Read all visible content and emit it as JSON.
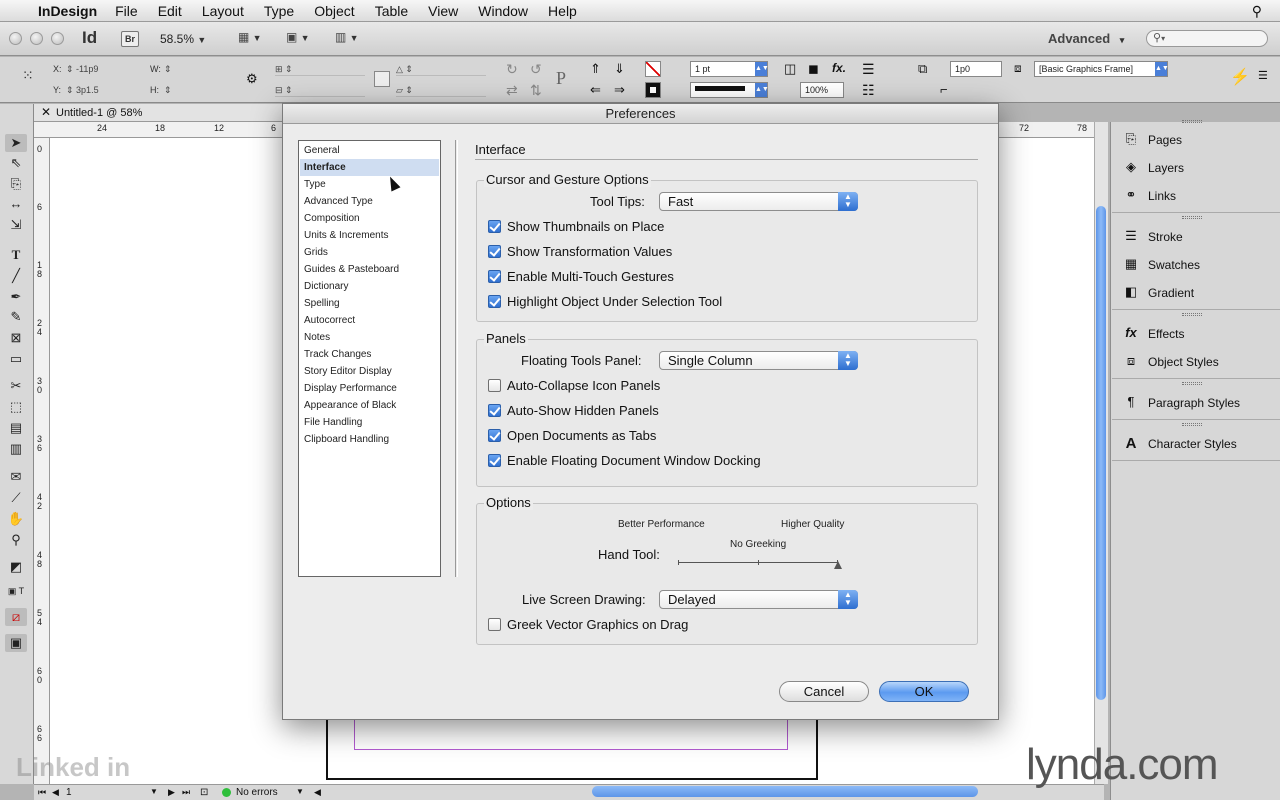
{
  "menubar": {
    "app_name": "InDesign",
    "items": [
      "File",
      "Edit",
      "Layout",
      "Type",
      "Object",
      "Table",
      "View",
      "Window",
      "Help"
    ]
  },
  "appbar": {
    "id_logo": "Id",
    "br_label": "Br",
    "zoom": "58.5%",
    "workspace": "Advanced"
  },
  "control": {
    "x_label": "X:",
    "x_value": "-11p9",
    "y_label": "Y:",
    "y_value": "3p1.5",
    "w_label": "W:",
    "h_label": "H:",
    "stroke_weight": "1 pt",
    "opacity": "100%",
    "fx_label": "fx.",
    "frame_value": "1p0",
    "object_style": "[Basic Graphics Frame]"
  },
  "document": {
    "tab_title": "Untitled-1 @ 58%",
    "ruler_top": [
      "24",
      "18",
      "12",
      "6",
      "72",
      "78"
    ],
    "ruler_left": [
      "0",
      "6",
      "1",
      "8",
      "2",
      "4",
      "3",
      "0",
      "3",
      "6",
      "4",
      "2",
      "4",
      "8",
      "5",
      "4",
      "6",
      "0",
      "6",
      "6"
    ]
  },
  "status": {
    "page": "1",
    "errors": "No errors"
  },
  "panels": [
    {
      "icon": "pages-icon",
      "label": "Pages"
    },
    {
      "icon": "layers-icon",
      "label": "Layers"
    },
    {
      "icon": "links-icon",
      "label": "Links"
    },
    {
      "icon": "stroke-icon",
      "label": "Stroke"
    },
    {
      "icon": "swatches-icon",
      "label": "Swatches"
    },
    {
      "icon": "gradient-icon",
      "label": "Gradient"
    },
    {
      "icon": "effects-icon",
      "label": "Effects"
    },
    {
      "icon": "object-styles-icon",
      "label": "Object Styles"
    },
    {
      "icon": "paragraph-styles-icon",
      "label": "Paragraph Styles"
    },
    {
      "icon": "character-styles-icon",
      "label": "Character Styles"
    }
  ],
  "dialog": {
    "title": "Preferences",
    "categories": [
      "General",
      "Interface",
      "Type",
      "Advanced Type",
      "Composition",
      "Units & Increments",
      "Grids",
      "Guides & Pasteboard",
      "Dictionary",
      "Spelling",
      "Autocorrect",
      "Notes",
      "Track Changes",
      "Story Editor Display",
      "Display Performance",
      "Appearance of Black",
      "File Handling",
      "Clipboard Handling"
    ],
    "selected_category": "Interface",
    "section_title": "Interface",
    "cursor_group": {
      "title": "Cursor and Gesture Options",
      "tooltips_label": "Tool Tips:",
      "tooltips_value": "Fast",
      "options": [
        {
          "label": "Show Thumbnails on Place",
          "checked": true
        },
        {
          "label": "Show Transformation Values",
          "checked": true
        },
        {
          "label": "Enable Multi-Touch Gestures",
          "checked": true
        },
        {
          "label": "Highlight Object Under Selection Tool",
          "checked": true
        }
      ]
    },
    "panels_group": {
      "title": "Panels",
      "floating_label": "Floating Tools Panel:",
      "floating_value": "Single Column",
      "options": [
        {
          "label": "Auto-Collapse Icon Panels",
          "checked": false
        },
        {
          "label": "Auto-Show Hidden Panels",
          "checked": true
        },
        {
          "label": "Open Documents as Tabs",
          "checked": true
        },
        {
          "label": "Enable Floating Document Window Docking",
          "checked": true
        }
      ]
    },
    "options_group": {
      "title": "Options",
      "better_performance": "Better Performance",
      "higher_quality": "Higher Quality",
      "no_greeking": "No Greeking",
      "hand_tool_label": "Hand Tool:",
      "hand_tool_level": 1.0,
      "live_label": "Live Screen Drawing:",
      "live_value": "Delayed",
      "greek_label": "Greek Vector Graphics on Drag",
      "greek_checked": false
    },
    "cancel_label": "Cancel",
    "ok_label": "OK"
  },
  "watermarks": {
    "linkedin": "Linked in",
    "lynda": "lynda.com"
  }
}
